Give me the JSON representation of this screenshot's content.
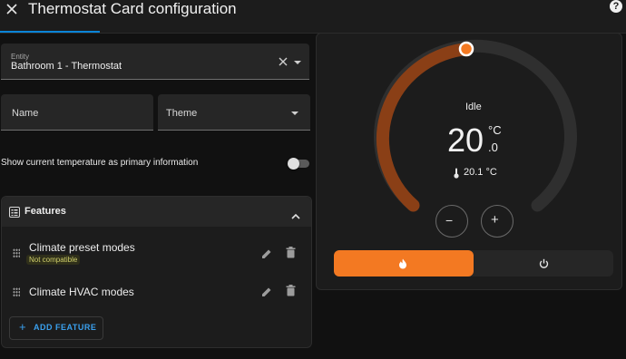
{
  "header": {
    "title": "Thermostat Card configuration",
    "close_icon": "close-icon",
    "help_icon": "help-icon",
    "help_glyph": "?"
  },
  "entity_field": {
    "label": "Entity",
    "value": "Bathroom 1 - Thermostat"
  },
  "name_field": {
    "placeholder": "Name"
  },
  "theme_field": {
    "placeholder": "Theme"
  },
  "primary_toggle": {
    "label": "Show current temperature as primary information",
    "enabled": false
  },
  "features": {
    "title": "Features",
    "items": [
      {
        "title": "Climate preset modes",
        "badge": "Not compatible"
      },
      {
        "title": "Climate HVAC modes"
      }
    ],
    "add_label": "ADD FEATURE"
  },
  "thermostat": {
    "status": "Idle",
    "target_whole": "20",
    "unit": "°C",
    "target_decimal": ".0",
    "current": "20.1 °C",
    "minus": "−",
    "plus": "+",
    "modes": [
      "heat",
      "off"
    ],
    "active_mode": "heat"
  },
  "colors": {
    "accent_blue": "#0a84d8",
    "heat_orange": "#f37922",
    "arc_fill": "#8a3f16",
    "arc_track": "#2f2f2f"
  }
}
